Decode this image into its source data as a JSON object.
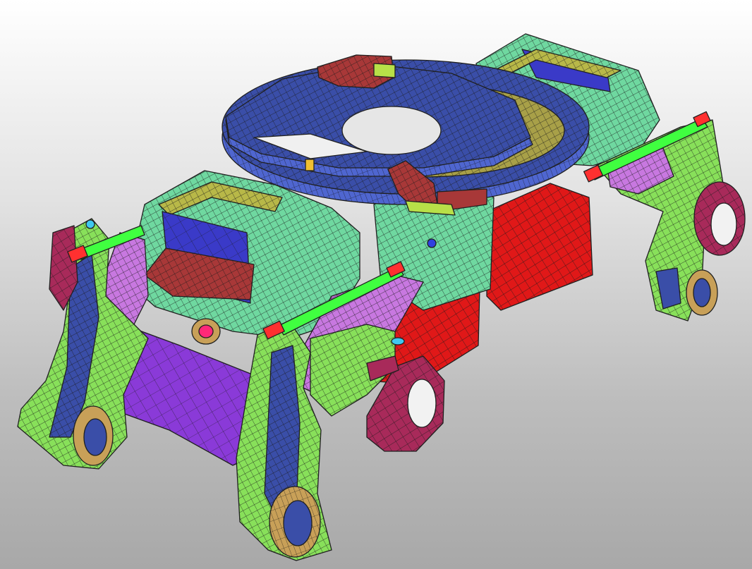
{
  "scene": {
    "subject": "finite-element-mesh-assembly",
    "background": {
      "top": "#ffffff",
      "bottom": "#a8a8a8"
    },
    "mesh_line_color": "#202020",
    "part_colors": {
      "frame_teal": "#6fd8a0",
      "suspension_green": "#88e05a",
      "plate_blue": "#3a4ea8",
      "plate_blue_side": "#4f66d0",
      "olive": "#b8b848",
      "red_block": "#e01818",
      "dark_red": "#a83838",
      "magenta_hub": "#a82a5a",
      "purple_beam": "#8a3ad8",
      "violet_link": "#c878e0",
      "bright_green_rod": "#40ff40",
      "rod_end_red": "#ff3030",
      "tan_bushing": "#c8a058",
      "cyan_pin": "#40c8f0"
    }
  }
}
